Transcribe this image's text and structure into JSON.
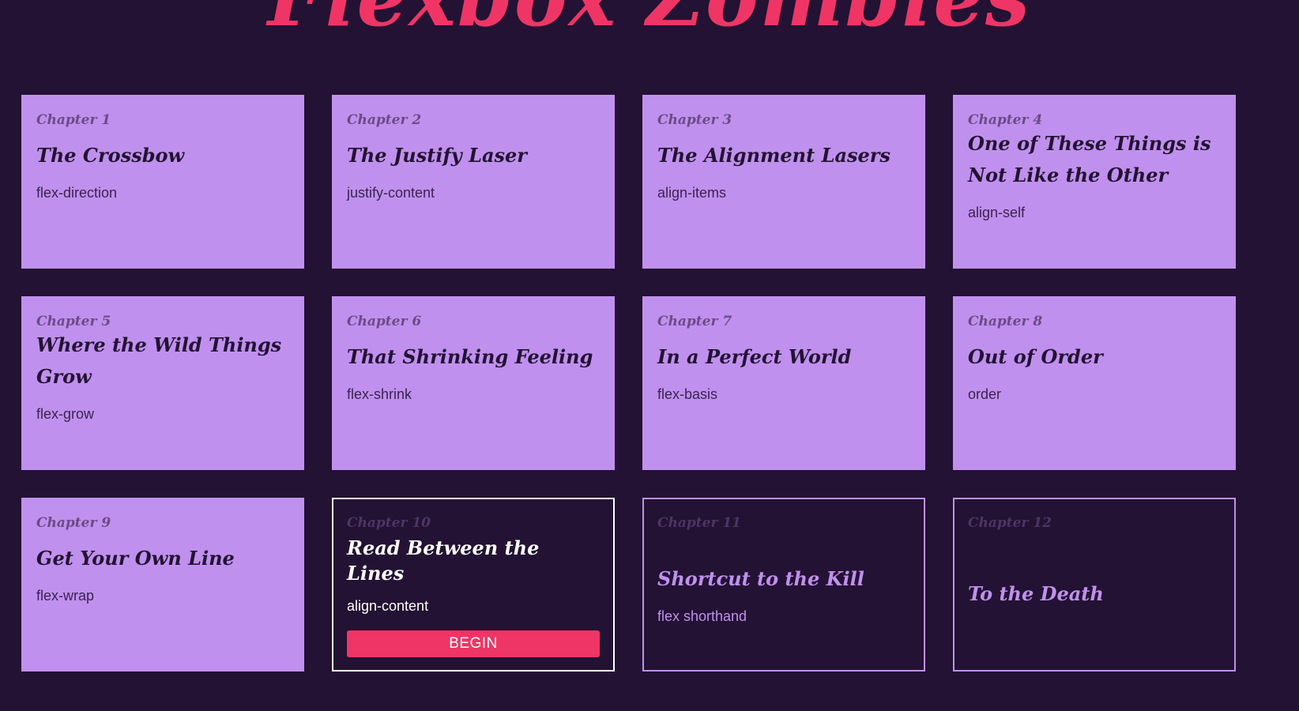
{
  "header": {
    "title": "Flexbox Zombies",
    "title_color": "#ef3565"
  },
  "theme": {
    "background": "#231233",
    "card_completed": "#c090ee",
    "current_border": "#ffffff",
    "locked_border": "#c090ee",
    "accent": "#ef3565"
  },
  "chapters": [
    {
      "number": "Chapter 1",
      "title": "The Crossbow",
      "topic": "flex-direction",
      "status": "completed"
    },
    {
      "number": "Chapter 2",
      "title": "The Justify Laser",
      "topic": "justify-content",
      "status": "completed"
    },
    {
      "number": "Chapter 3",
      "title": "The Alignment Lasers",
      "topic": "align-items",
      "status": "completed"
    },
    {
      "number": "Chapter 4",
      "title": "One of These Things is Not Like the Other",
      "topic": "align-self",
      "status": "completed"
    },
    {
      "number": "Chapter 5",
      "title": "Where the Wild Things Grow",
      "topic": "flex-grow",
      "status": "completed"
    },
    {
      "number": "Chapter 6",
      "title": "That Shrinking Feeling",
      "topic": "flex-shrink",
      "status": "completed"
    },
    {
      "number": "Chapter 7",
      "title": "In a Perfect World",
      "topic": "flex-basis",
      "status": "completed"
    },
    {
      "number": "Chapter 8",
      "title": "Out of Order",
      "topic": "order",
      "status": "completed"
    },
    {
      "number": "Chapter 9",
      "title": "Get Your Own Line",
      "topic": "flex-wrap",
      "status": "completed"
    },
    {
      "number": "Chapter 10",
      "title": "Read Between the Lines",
      "topic": "align-content",
      "status": "current",
      "action_label": "BEGIN"
    },
    {
      "number": "Chapter 11",
      "title": "Shortcut to the Kill",
      "topic": "flex shorthand",
      "status": "locked"
    },
    {
      "number": "Chapter 12",
      "title": "To the Death",
      "topic": "",
      "status": "locked"
    }
  ]
}
